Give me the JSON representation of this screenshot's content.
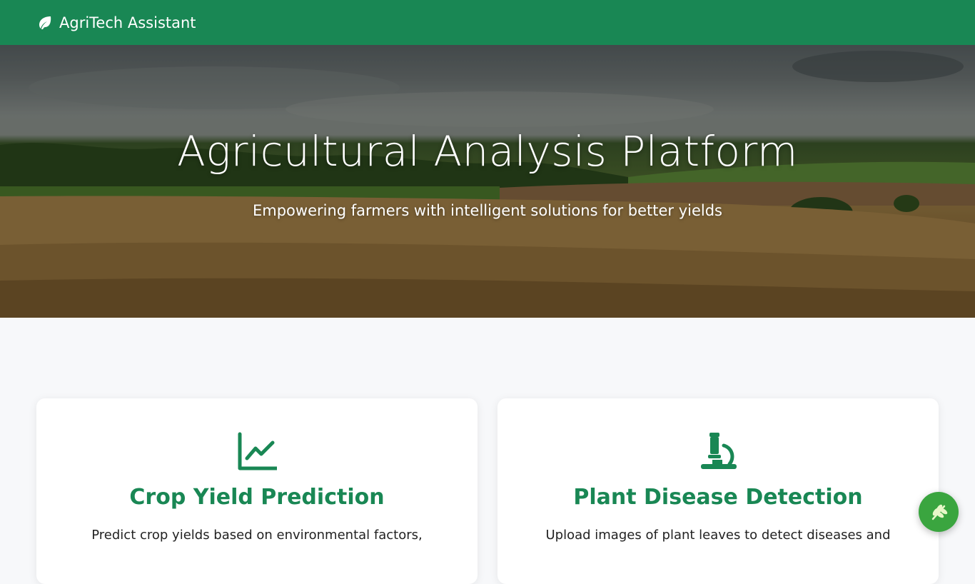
{
  "navbar": {
    "brand": "AgriTech Assistant",
    "brand_icon": "leaf-icon",
    "background": "#198754"
  },
  "hero": {
    "title": "Agricultural Analysis Platform",
    "subtitle": "Empowering farmers with intelligent solutions for better yields"
  },
  "cards": [
    {
      "icon": "chart-line-icon",
      "title": "Crop Yield Prediction",
      "description": "Predict crop yields based on environmental factors,"
    },
    {
      "icon": "microscope-icon",
      "title": "Plant Disease Detection",
      "description": "Upload images of plant leaves to detect diseases and"
    }
  ],
  "fab": {
    "icon": "seedling-icon",
    "color": "#3aa53f"
  },
  "colors": {
    "accent": "#198754"
  }
}
